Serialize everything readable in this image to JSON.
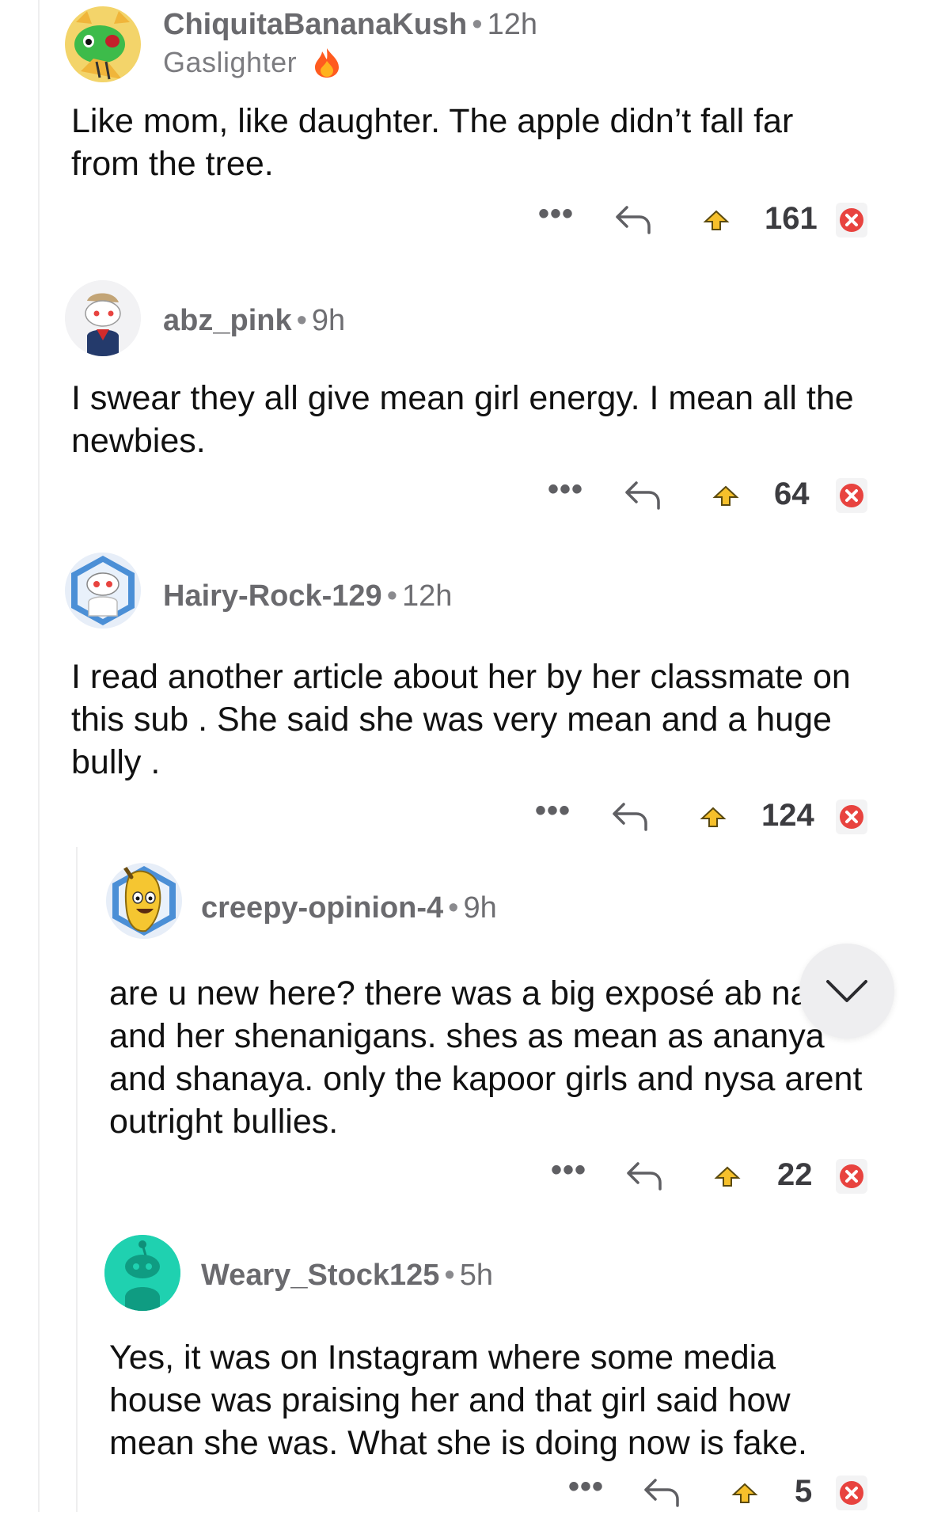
{
  "comments": [
    {
      "username": "ChiquitaBananaKush",
      "time": "12h",
      "flair": "Gaslighter",
      "body": "Like mom, like daughter. The apple didn’t fall far from the tree.",
      "score": "161",
      "avatar_icon": "tiger-green-face-avatar"
    },
    {
      "username": "abz_pink",
      "time": "9h",
      "body": "I swear they all give mean girl energy. I mean all the newbies.",
      "score": "64",
      "avatar_icon": "snoo-sailor-avatar"
    },
    {
      "username": "Hairy-Rock-129",
      "time": "12h",
      "body": "I read another article about her by her classmate on this sub . She said she was very mean and a huge  bully .",
      "score": "124",
      "avatar_icon": "snoo-scientist-avatar"
    },
    {
      "username": "creepy-opinion-4",
      "time": "9h",
      "body": "are u new here? there was a big exposé ab navya and her shenanigans. shes as mean as ananya and shanaya. only the kapoor girls and nysa arent outright bullies.",
      "score": "22",
      "avatar_icon": "banana-snoo-avatar"
    },
    {
      "username": "Weary_Stock125",
      "time": "5h",
      "body": "Yes, it was on Instagram where some media house was praising her and that girl said how mean she was. What she is doing now is fake.",
      "score": "5",
      "avatar_icon": "default-teal-snoo-avatar"
    }
  ],
  "icons": {
    "more": "more-options-icon",
    "reply": "reply-arrow-icon",
    "award": "award-icon",
    "downvote": "downvote-x-icon",
    "fire": "fire-icon",
    "collapse": "chevron-down-icon"
  },
  "actions": {
    "more_label": "•••"
  },
  "colors": {
    "downvote_red": "#e8433f",
    "award_yellow": "#f6c02b",
    "teal_avatar": "#1fd1b0",
    "thread_line": "#eeeeef"
  }
}
